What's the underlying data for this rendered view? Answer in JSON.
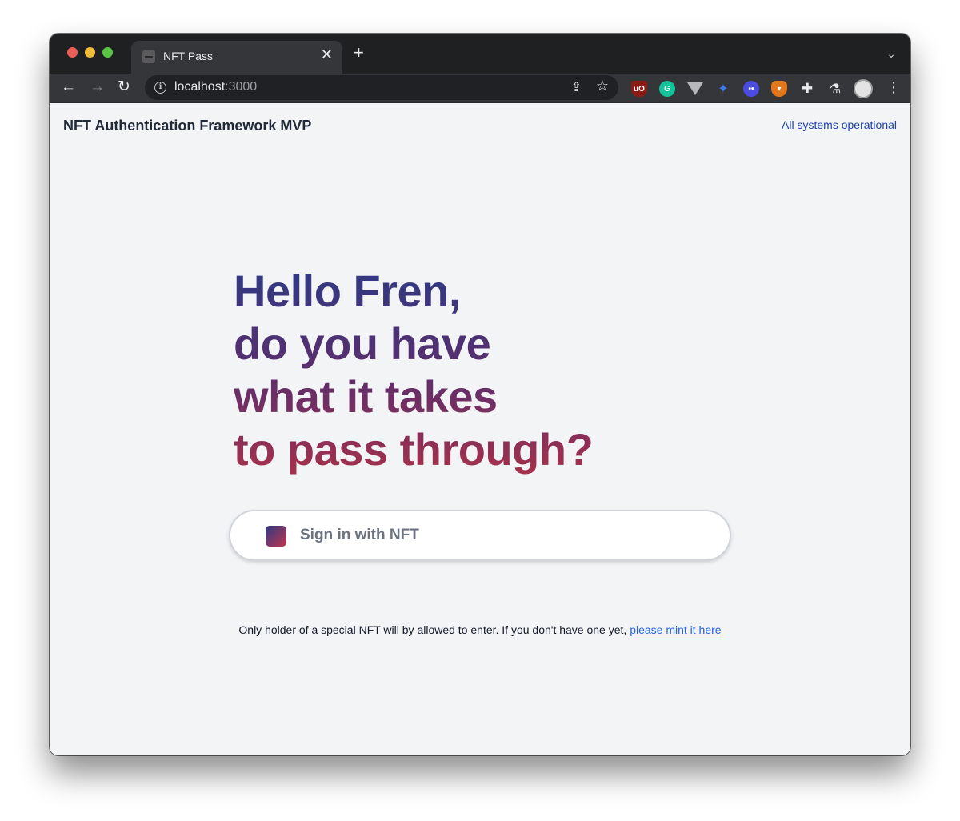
{
  "browser": {
    "tab_title": "NFT Pass",
    "tab_close": "✕",
    "new_tab": "+",
    "tab_search": "⌄",
    "url_host": "localhost",
    "url_port": ":3000",
    "extensions": [
      "ublock-origin",
      "grammarly",
      "vue-devtools",
      "satellite",
      "ghost",
      "metamask",
      "extensions-puzzle",
      "labs-flask"
    ]
  },
  "header": {
    "brand": "NFT Authentication Framework MVP",
    "status": "All systems operational"
  },
  "hero": {
    "lines": [
      "Hello Fren,",
      "do you have",
      "what it takes",
      "to pass through?"
    ]
  },
  "signin": {
    "label": "Sign in with NFT"
  },
  "notice": {
    "text": "Only holder of a special NFT will by allowed to enter. If you don't have one yet, ",
    "link": "please mint it here"
  },
  "colors": {
    "gradient_start": "#2e3a83",
    "gradient_end": "#a6304a",
    "status_link": "#1e40af",
    "mint_link": "#2563eb"
  }
}
